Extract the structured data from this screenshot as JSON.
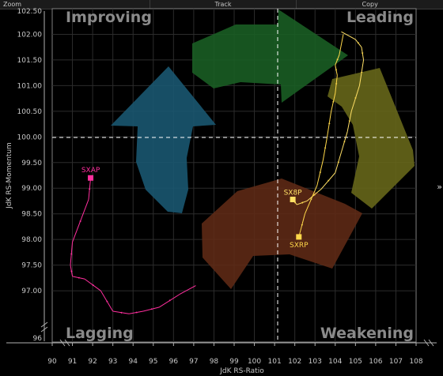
{
  "toolbar": {
    "zoom": "Zoom",
    "track": "Track",
    "copy": "Copy"
  },
  "side_toggle": "»",
  "quadrants": {
    "top_left": "Improving",
    "top_right": "Leading",
    "bottom_left": "Lagging",
    "bottom_right": "Weakening"
  },
  "colors": {
    "SXAP": "#ff2f9e",
    "SX8P": "#ffe066",
    "SXRP": "#ffd84a",
    "arrow_green": "#1a5e24",
    "arrow_yellow": "#66661a",
    "arrow_red": "#5e2a16",
    "arrow_blue": "#1a5770"
  },
  "chart_data": {
    "type": "scatter",
    "xlabel": "JdK RS-Ratio",
    "ylabel": "JdK RS-Momentum",
    "xlim": [
      90,
      108
    ],
    "ylim": [
      96,
      102.5
    ],
    "center": [
      100,
      100
    ],
    "x_ticks": [
      90,
      91,
      92,
      93,
      94,
      95,
      96,
      97,
      98,
      99,
      100,
      101,
      102,
      103,
      104,
      105,
      106,
      107,
      108
    ],
    "y_ticks": [
      96,
      97.0,
      97.5,
      98.0,
      98.5,
      99.0,
      99.5,
      100.0,
      100.5,
      101.0,
      101.5,
      102.0,
      102.5
    ],
    "grid": true,
    "series": [
      {
        "name": "SXAP",
        "points": [
          [
            97.1,
            97.1
          ],
          [
            96.3,
            96.93
          ],
          [
            95.3,
            96.68
          ],
          [
            94.5,
            96.6
          ],
          [
            93.8,
            96.55
          ],
          [
            93.0,
            96.6
          ],
          [
            92.4,
            97.0
          ],
          [
            91.6,
            97.23
          ],
          [
            91.0,
            97.28
          ],
          [
            90.9,
            97.5
          ],
          [
            91.0,
            97.95
          ],
          [
            91.8,
            98.78
          ],
          [
            91.9,
            99.2
          ]
        ]
      },
      {
        "name": "SX8P",
        "points": [
          [
            104.3,
            102.05
          ],
          [
            105.0,
            101.9
          ],
          [
            105.3,
            101.75
          ],
          [
            105.4,
            101.5
          ],
          [
            105.2,
            101.0
          ],
          [
            104.8,
            100.5
          ],
          [
            104.6,
            100.1
          ],
          [
            104.3,
            99.7
          ],
          [
            104.0,
            99.3
          ],
          [
            103.3,
            98.98
          ],
          [
            102.6,
            98.75
          ],
          [
            102.1,
            98.68
          ],
          [
            101.9,
            98.78
          ]
        ]
      },
      {
        "name": "SXRP",
        "points": [
          [
            104.4,
            102.0
          ],
          [
            104.2,
            101.6
          ],
          [
            104.0,
            101.4
          ],
          [
            104.1,
            101.2
          ],
          [
            104.0,
            100.85
          ],
          [
            103.8,
            100.5
          ],
          [
            103.6,
            100.0
          ],
          [
            103.4,
            99.55
          ],
          [
            103.1,
            99.05
          ],
          [
            102.5,
            98.5
          ],
          [
            102.2,
            98.05
          ]
        ]
      }
    ]
  }
}
